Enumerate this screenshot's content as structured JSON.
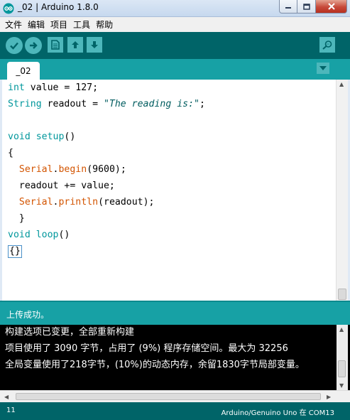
{
  "window": {
    "title": "_02 | Arduino 1.8.0"
  },
  "menu": [
    "文件",
    "编辑",
    "项目",
    "工具",
    "帮助"
  ],
  "toolbar": {
    "buttons": [
      "verify-icon",
      "upload-icon",
      "new-icon",
      "open-icon",
      "save-icon"
    ],
    "serial_monitor": "serial-monitor-icon"
  },
  "tabs": [
    {
      "label": "_02"
    }
  ],
  "editor": {
    "lines": [
      {
        "tokens": [
          {
            "t": "int",
            "c": "k-type"
          },
          {
            "t": " value = 127;"
          }
        ]
      },
      {
        "tokens": [
          {
            "t": "String",
            "c": "k-type"
          },
          {
            "t": " readout = "
          },
          {
            "t": "\"The reading is:\"",
            "c": "k-str"
          },
          {
            "t": ";"
          }
        ]
      },
      {
        "tokens": []
      },
      {
        "tokens": [
          {
            "t": "void",
            "c": "k-type"
          },
          {
            "t": " "
          },
          {
            "t": "setup",
            "c": "k-def"
          },
          {
            "t": "()"
          }
        ]
      },
      {
        "tokens": [
          {
            "t": "{"
          }
        ]
      },
      {
        "tokens": [
          {
            "t": "  "
          },
          {
            "t": "Serial",
            "c": "k-cls"
          },
          {
            "t": "."
          },
          {
            "t": "begin",
            "c": "k-fn"
          },
          {
            "t": "(9600);"
          }
        ]
      },
      {
        "tokens": [
          {
            "t": "  readout += value;"
          }
        ]
      },
      {
        "tokens": [
          {
            "t": "  "
          },
          {
            "t": "Serial",
            "c": "k-cls"
          },
          {
            "t": "."
          },
          {
            "t": "println",
            "c": "k-fn"
          },
          {
            "t": "(readout);"
          }
        ]
      },
      {
        "tokens": [
          {
            "t": "  }"
          }
        ]
      },
      {
        "tokens": [
          {
            "t": "void",
            "c": "k-type"
          },
          {
            "t": " "
          },
          {
            "t": "loop",
            "c": "k-def"
          },
          {
            "t": "()"
          }
        ]
      },
      {
        "tokens": [
          {
            "t": "{}",
            "c": "caret"
          }
        ]
      }
    ]
  },
  "status": {
    "message": "上传成功。"
  },
  "console": {
    "lines": [
      "构建选项已变更，全部重新构建",
      "项目使用了 3090 字节，占用了 (9%) 程序存储空间。最大为 32256",
      "全局变量使用了218字节，(10%)的动态内存，余留1830字节局部变量。"
    ]
  },
  "footer": {
    "line_number": "11",
    "board": "Arduino/Genuino Uno 在 COM13"
  },
  "colors": {
    "toolbar": "#006468",
    "tabbar": "#17a1a5",
    "button": "#4db7bb"
  }
}
